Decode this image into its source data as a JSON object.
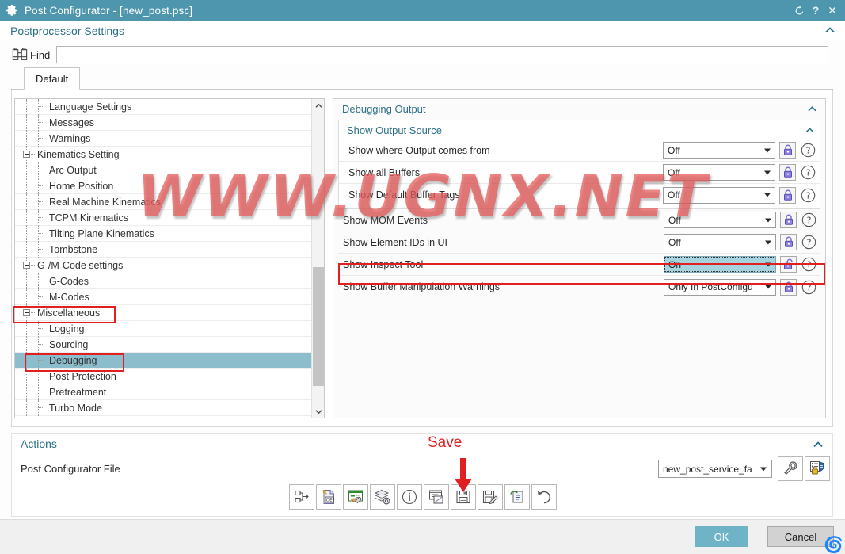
{
  "window": {
    "title": "Post Configurator - [new_post.psc]",
    "gear_icon": "gear-icon",
    "controls": [
      {
        "name": "reset-icon",
        "glyph": "↺"
      },
      {
        "name": "help-icon",
        "glyph": "?"
      },
      {
        "name": "close-icon",
        "glyph": "✕"
      }
    ],
    "titlebar_color": "#4e96ad"
  },
  "settings": {
    "title": "Postprocessor Settings",
    "collapse_glyph": "⌃"
  },
  "find": {
    "label": "Find",
    "value": "",
    "placeholder": "",
    "icon": "binoculars-icon"
  },
  "tabs": [
    {
      "label": "Default",
      "active": true
    }
  ],
  "tree": {
    "items": [
      {
        "label": "Language Settings",
        "level": 2,
        "expander": false,
        "selected": false
      },
      {
        "label": "Messages",
        "level": 2,
        "expander": false,
        "selected": false
      },
      {
        "label": "Warnings",
        "level": 2,
        "expander": false,
        "selected": false
      },
      {
        "label": "Kinematics Setting",
        "level": 1,
        "expander": true,
        "selected": false
      },
      {
        "label": "Arc Output",
        "level": 2,
        "expander": false,
        "selected": false
      },
      {
        "label": "Home Position",
        "level": 2,
        "expander": false,
        "selected": false
      },
      {
        "label": "Real Machine Kinematics",
        "level": 2,
        "expander": false,
        "selected": false
      },
      {
        "label": "TCPM Kinematics",
        "level": 2,
        "expander": false,
        "selected": false
      },
      {
        "label": "Tilting Plane Kinematics",
        "level": 2,
        "expander": false,
        "selected": false
      },
      {
        "label": "Tombstone",
        "level": 2,
        "expander": false,
        "selected": false
      },
      {
        "label": "G-/M-Code settings",
        "level": 1,
        "expander": true,
        "selected": false
      },
      {
        "label": "G-Codes",
        "level": 2,
        "expander": false,
        "selected": false
      },
      {
        "label": "M-Codes",
        "level": 2,
        "expander": false,
        "selected": false
      },
      {
        "label": "Miscellaneous",
        "level": 1,
        "expander": true,
        "selected": false,
        "highlight": true
      },
      {
        "label": "Logging",
        "level": 2,
        "expander": false,
        "selected": false
      },
      {
        "label": "Sourcing",
        "level": 2,
        "expander": false,
        "selected": false
      },
      {
        "label": "Debugging",
        "level": 2,
        "expander": false,
        "selected": true,
        "highlight": true
      },
      {
        "label": "Post Protection",
        "level": 2,
        "expander": false,
        "selected": false
      },
      {
        "label": "Pretreatment",
        "level": 2,
        "expander": false,
        "selected": false
      },
      {
        "label": "Turbo Mode",
        "level": 2,
        "expander": false,
        "selected": false
      }
    ],
    "scroll_up_glyph": "⌃",
    "scroll_down_glyph": "⌄"
  },
  "panel": {
    "title": "Debugging Output",
    "collapse_glyph": "⌃",
    "subgroup": {
      "title": "Show Output Source",
      "collapse_glyph": "⌃",
      "rows": [
        {
          "label": "Show where Output comes from",
          "value": "Off",
          "locked": true,
          "focused": false
        },
        {
          "label": "Show all Buffers",
          "value": "Off",
          "locked": true,
          "focused": false
        },
        {
          "label": "Show Default Buffer Tags",
          "value": "Off",
          "locked": true,
          "focused": false
        }
      ]
    },
    "rows": [
      {
        "label": "Show MOM Events",
        "value": "Off",
        "locked": true,
        "focused": false
      },
      {
        "label": "Show Element IDs in UI",
        "value": "Off",
        "locked": true,
        "focused": false
      },
      {
        "label": "Show Inspect Tool",
        "value": "On",
        "locked": false,
        "focused": true,
        "highlight": true
      },
      {
        "label": "Show Buffer Manipulation Warnings",
        "value": "Only In PostConfigu",
        "locked": true,
        "focused": false
      }
    ],
    "help_glyph": "?"
  },
  "actions": {
    "title": "Actions",
    "collapse_glyph": "⌃",
    "subtitle": "Post Configurator File",
    "annotation": "Save",
    "toolbar": [
      {
        "name": "export-structure-icon",
        "tooltip": ""
      },
      {
        "name": "def-file-icon",
        "tooltip": ""
      },
      {
        "name": "edit-ui-icon",
        "tooltip": ""
      },
      {
        "name": "layers-settings-icon",
        "tooltip": ""
      },
      {
        "name": "info-icon",
        "tooltip": ""
      },
      {
        "name": "copy-edit-icon",
        "tooltip": ""
      },
      {
        "name": "save-icon",
        "tooltip": ""
      },
      {
        "name": "save-as-icon",
        "tooltip": ""
      },
      {
        "name": "reload-file-icon",
        "tooltip": ""
      },
      {
        "name": "undo-icon",
        "tooltip": ""
      }
    ],
    "post_select": {
      "value": "new_post_service_fa"
    },
    "right_icons": [
      {
        "name": "wrench-icon"
      },
      {
        "name": "protection-icon"
      }
    ]
  },
  "footer": {
    "ok_label": "OK",
    "cancel_label": "Cancel",
    "ok_color": "#6fb3c7"
  },
  "watermark": {
    "text": "WWW.UGNX.NET",
    "color": "#e85858"
  }
}
